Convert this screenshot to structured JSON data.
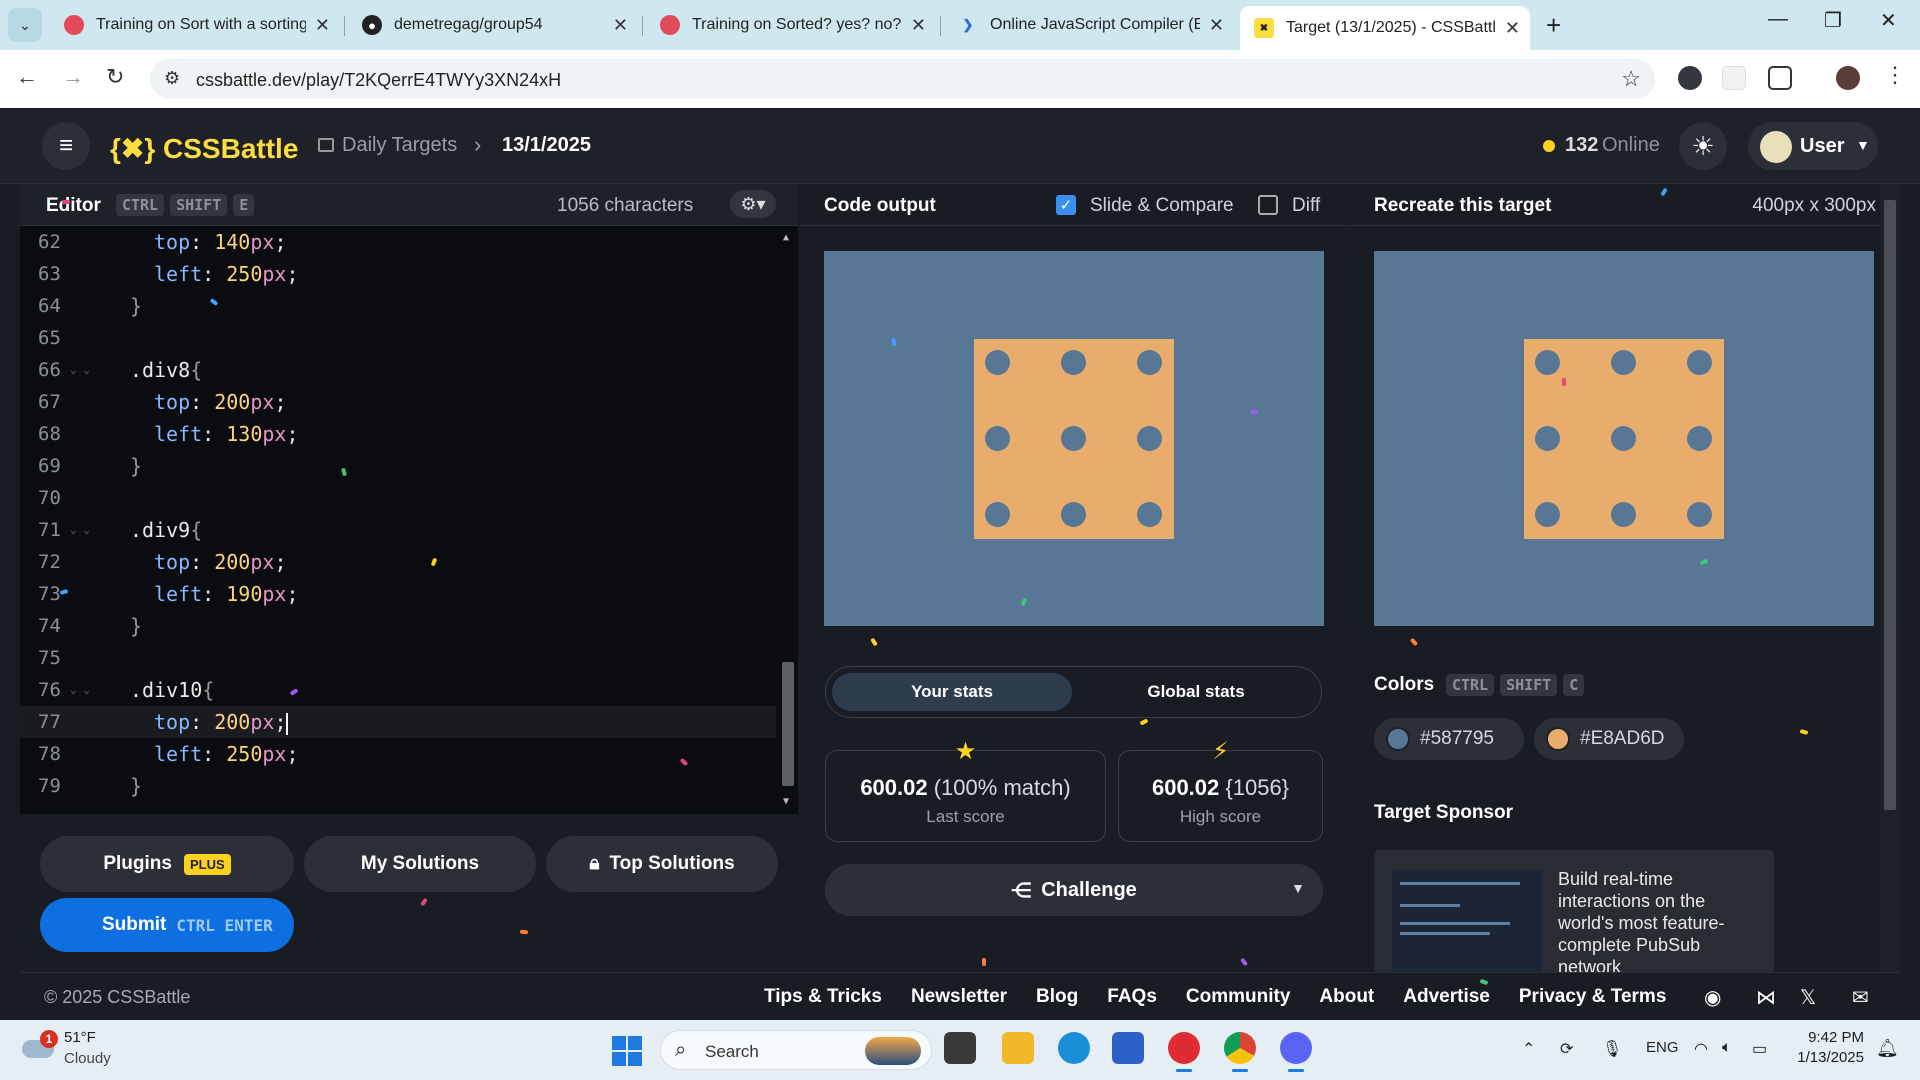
{
  "browser": {
    "tabs": [
      {
        "title": "Training on Sort with a sorting a",
        "favicon_color": "#e24c5a"
      },
      {
        "title": "demetregag/group54",
        "favicon_color": "#222222"
      },
      {
        "title": "Training on Sorted? yes? no? ho",
        "favicon_color": "#e24c5a"
      },
      {
        "title": "Online JavaScript Compiler (Edi",
        "favicon_color": "#2d6ae3"
      },
      {
        "title": "Target (13/1/2025) - CSSBattle",
        "favicon_color": "#ffdd40"
      }
    ],
    "url": "cssbattle.dev/play/T2KQerrE4TWYy3XN24xH"
  },
  "header": {
    "logo": "{✖} CSSBattle",
    "breadcrumb_1": "Daily Targets",
    "breadcrumb_2": "13/1/2025",
    "online_count": "132",
    "online_label": "Online",
    "user_name": "User"
  },
  "editor": {
    "title": "Editor",
    "shortcut": [
      "CTRL",
      "SHIFT",
      "E"
    ],
    "char_count": "1056 characters",
    "lines": [
      {
        "n": "62",
        "indent": 2,
        "prop": "top",
        "value": "140",
        "unit": "px"
      },
      {
        "n": "63",
        "indent": 2,
        "prop": "left",
        "value": "250",
        "unit": "px"
      },
      {
        "n": "64",
        "indent": 1,
        "text": "}"
      },
      {
        "n": "65",
        "indent": 0,
        "text": ""
      },
      {
        "n": "66",
        "indent": 1,
        "selector": ".div8",
        "fold": true
      },
      {
        "n": "67",
        "indent": 2,
        "prop": "top",
        "value": "200",
        "unit": "px"
      },
      {
        "n": "68",
        "indent": 2,
        "prop": "left",
        "value": "130",
        "unit": "px"
      },
      {
        "n": "69",
        "indent": 1,
        "text": "}"
      },
      {
        "n": "70",
        "indent": 0,
        "text": ""
      },
      {
        "n": "71",
        "indent": 1,
        "selector": ".div9",
        "fold": true
      },
      {
        "n": "72",
        "indent": 2,
        "prop": "top",
        "value": "200",
        "unit": "px"
      },
      {
        "n": "73",
        "indent": 2,
        "prop": "left",
        "value": "190",
        "unit": "px"
      },
      {
        "n": "74",
        "indent": 1,
        "text": "}"
      },
      {
        "n": "75",
        "indent": 0,
        "text": ""
      },
      {
        "n": "76",
        "indent": 1,
        "selector": ".div10",
        "fold": true
      },
      {
        "n": "77",
        "indent": 2,
        "prop": "top",
        "value": "200",
        "unit": "px",
        "current": true
      },
      {
        "n": "78",
        "indent": 2,
        "prop": "left",
        "value": "250",
        "unit": "px"
      },
      {
        "n": "79",
        "indent": 1,
        "text": "}"
      }
    ],
    "buttons": {
      "plugins": "Plugins",
      "plugins_badge": "PLUS",
      "my_solutions": "My Solutions",
      "top_solutions": "Top Solutions",
      "submit": "Submit",
      "submit_keys": "CTRL ENTER"
    }
  },
  "output": {
    "title": "Code output",
    "slide_compare": "Slide & Compare",
    "slide_compare_checked": true,
    "diff": "Diff",
    "diff_checked": false,
    "stats_tabs": [
      "Your stats",
      "Global stats"
    ],
    "last_score_value": "600.02",
    "last_score_match": "(100% match)",
    "last_score_label": "Last score",
    "high_score_value": "600.02",
    "high_score_chars": "{1056}",
    "high_score_label": "High score",
    "challenge": "Challenge"
  },
  "target": {
    "title": "Recreate this target",
    "size": "400px x 300px",
    "colors_label": "Colors",
    "colors_keys": [
      "CTRL",
      "SHIFT",
      "C"
    ],
    "colors": [
      "#587795",
      "#E8AD6D"
    ],
    "sponsor_label": "Target Sponsor",
    "sponsor_text": "Build real-time interactions on the world's most feature-complete PubSub network"
  },
  "footer": {
    "copyright": "© 2025 CSSBattle",
    "links": [
      "Tips & Tricks",
      "Newsletter",
      "Blog",
      "FAQs",
      "Community",
      "About",
      "Advertise",
      "Privacy & Terms"
    ]
  },
  "taskbar": {
    "temp": "51°F",
    "condition": "Cloudy",
    "alert_count": "1",
    "search": "Search",
    "lang": "ENG",
    "time": "9:42 PM",
    "date": "1/13/2025"
  }
}
